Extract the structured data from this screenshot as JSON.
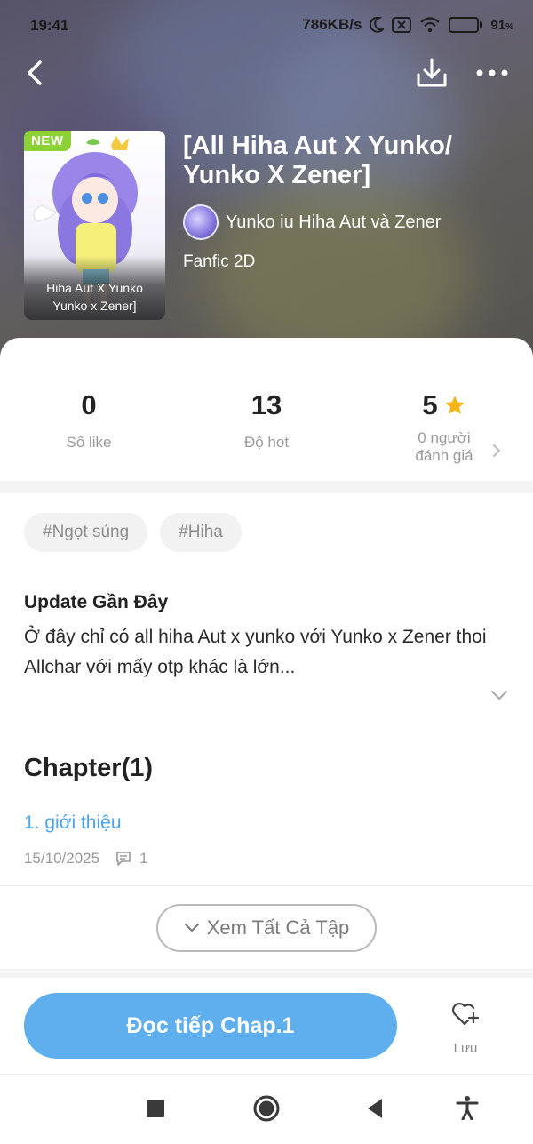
{
  "status_bar": {
    "time": "19:41",
    "speed": "786KB/s",
    "battery_percent": "91",
    "battery_unit": "%",
    "battery_level": 0.91,
    "icons": [
      "moon-icon",
      "sim-x-icon",
      "wifi-icon",
      "battery-icon"
    ]
  },
  "nav": {
    "icons": [
      "back-arrow-icon",
      "download-icon",
      "more-dots-icon"
    ]
  },
  "book": {
    "badge": "NEW",
    "cover_caption": "Hiha Aut X Yunko\nYunko x Zener]",
    "title": "[All Hiha Aut X Yunko/ Yunko X Zener]",
    "author": "Yunko iu Hiha Aut và Zener",
    "genre": "Fanfic 2D"
  },
  "stats": {
    "likes_value": "0",
    "likes_label": "Số like",
    "hot_value": "13",
    "hot_label": "Độ hot",
    "rating_value": "5",
    "rating_label": "0 người\nđánh giá"
  },
  "tags": [
    "#Ngọt sủng",
    "#Hiha"
  ],
  "update": {
    "heading": "Update Gần Đây",
    "text": "Ở đây chỉ có all hiha Aut x yunko với Yunko x Zener thoi\nAllchar với mấy otp khác là lớn..."
  },
  "chapters": {
    "heading": "Chapter(1)",
    "items": [
      {
        "title": "1. giới thiệu",
        "date": "15/10/2025",
        "comments": "1"
      }
    ],
    "view_all": "Xem Tất Cả Tập"
  },
  "actions": {
    "read_button": "Đọc tiếp Chap.1",
    "save_label": "Lưu"
  },
  "colors": {
    "accent": "#5fafef",
    "link": "#4aa3f0",
    "badge_new": "#8cd236",
    "star": "#f6b514"
  }
}
